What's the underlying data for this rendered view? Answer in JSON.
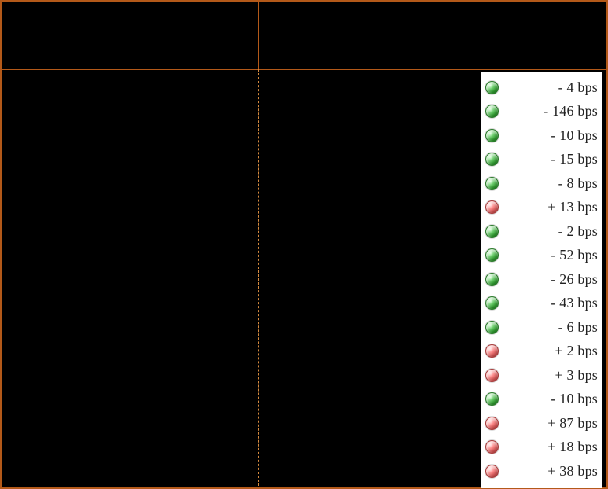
{
  "colors": {
    "green": "#2fa52f",
    "red": "#e85a5a",
    "border": "#b35919"
  },
  "rows": [
    {
      "direction": "down",
      "sign": "-",
      "value": 4,
      "unit": "bps"
    },
    {
      "direction": "down",
      "sign": "-",
      "value": 146,
      "unit": "bps"
    },
    {
      "direction": "down",
      "sign": "-",
      "value": 10,
      "unit": "bps"
    },
    {
      "direction": "down",
      "sign": "-",
      "value": 15,
      "unit": "bps"
    },
    {
      "direction": "down",
      "sign": "-",
      "value": 8,
      "unit": "bps"
    },
    {
      "direction": "up",
      "sign": "+",
      "value": 13,
      "unit": "bps"
    },
    {
      "direction": "down",
      "sign": "-",
      "value": 2,
      "unit": "bps"
    },
    {
      "direction": "down",
      "sign": "-",
      "value": 52,
      "unit": "bps"
    },
    {
      "direction": "down",
      "sign": "-",
      "value": 26,
      "unit": "bps"
    },
    {
      "direction": "down",
      "sign": "-",
      "value": 43,
      "unit": "bps"
    },
    {
      "direction": "down",
      "sign": "-",
      "value": 6,
      "unit": "bps"
    },
    {
      "direction": "up",
      "sign": "+",
      "value": 2,
      "unit": "bps"
    },
    {
      "direction": "up",
      "sign": "+",
      "value": 3,
      "unit": "bps"
    },
    {
      "direction": "down",
      "sign": "-",
      "value": 10,
      "unit": "bps"
    },
    {
      "direction": "up",
      "sign": "+",
      "value": 87,
      "unit": "bps"
    },
    {
      "direction": "up",
      "sign": "+",
      "value": 18,
      "unit": "bps"
    },
    {
      "direction": "up",
      "sign": "+",
      "value": 38,
      "unit": "bps"
    }
  ]
}
